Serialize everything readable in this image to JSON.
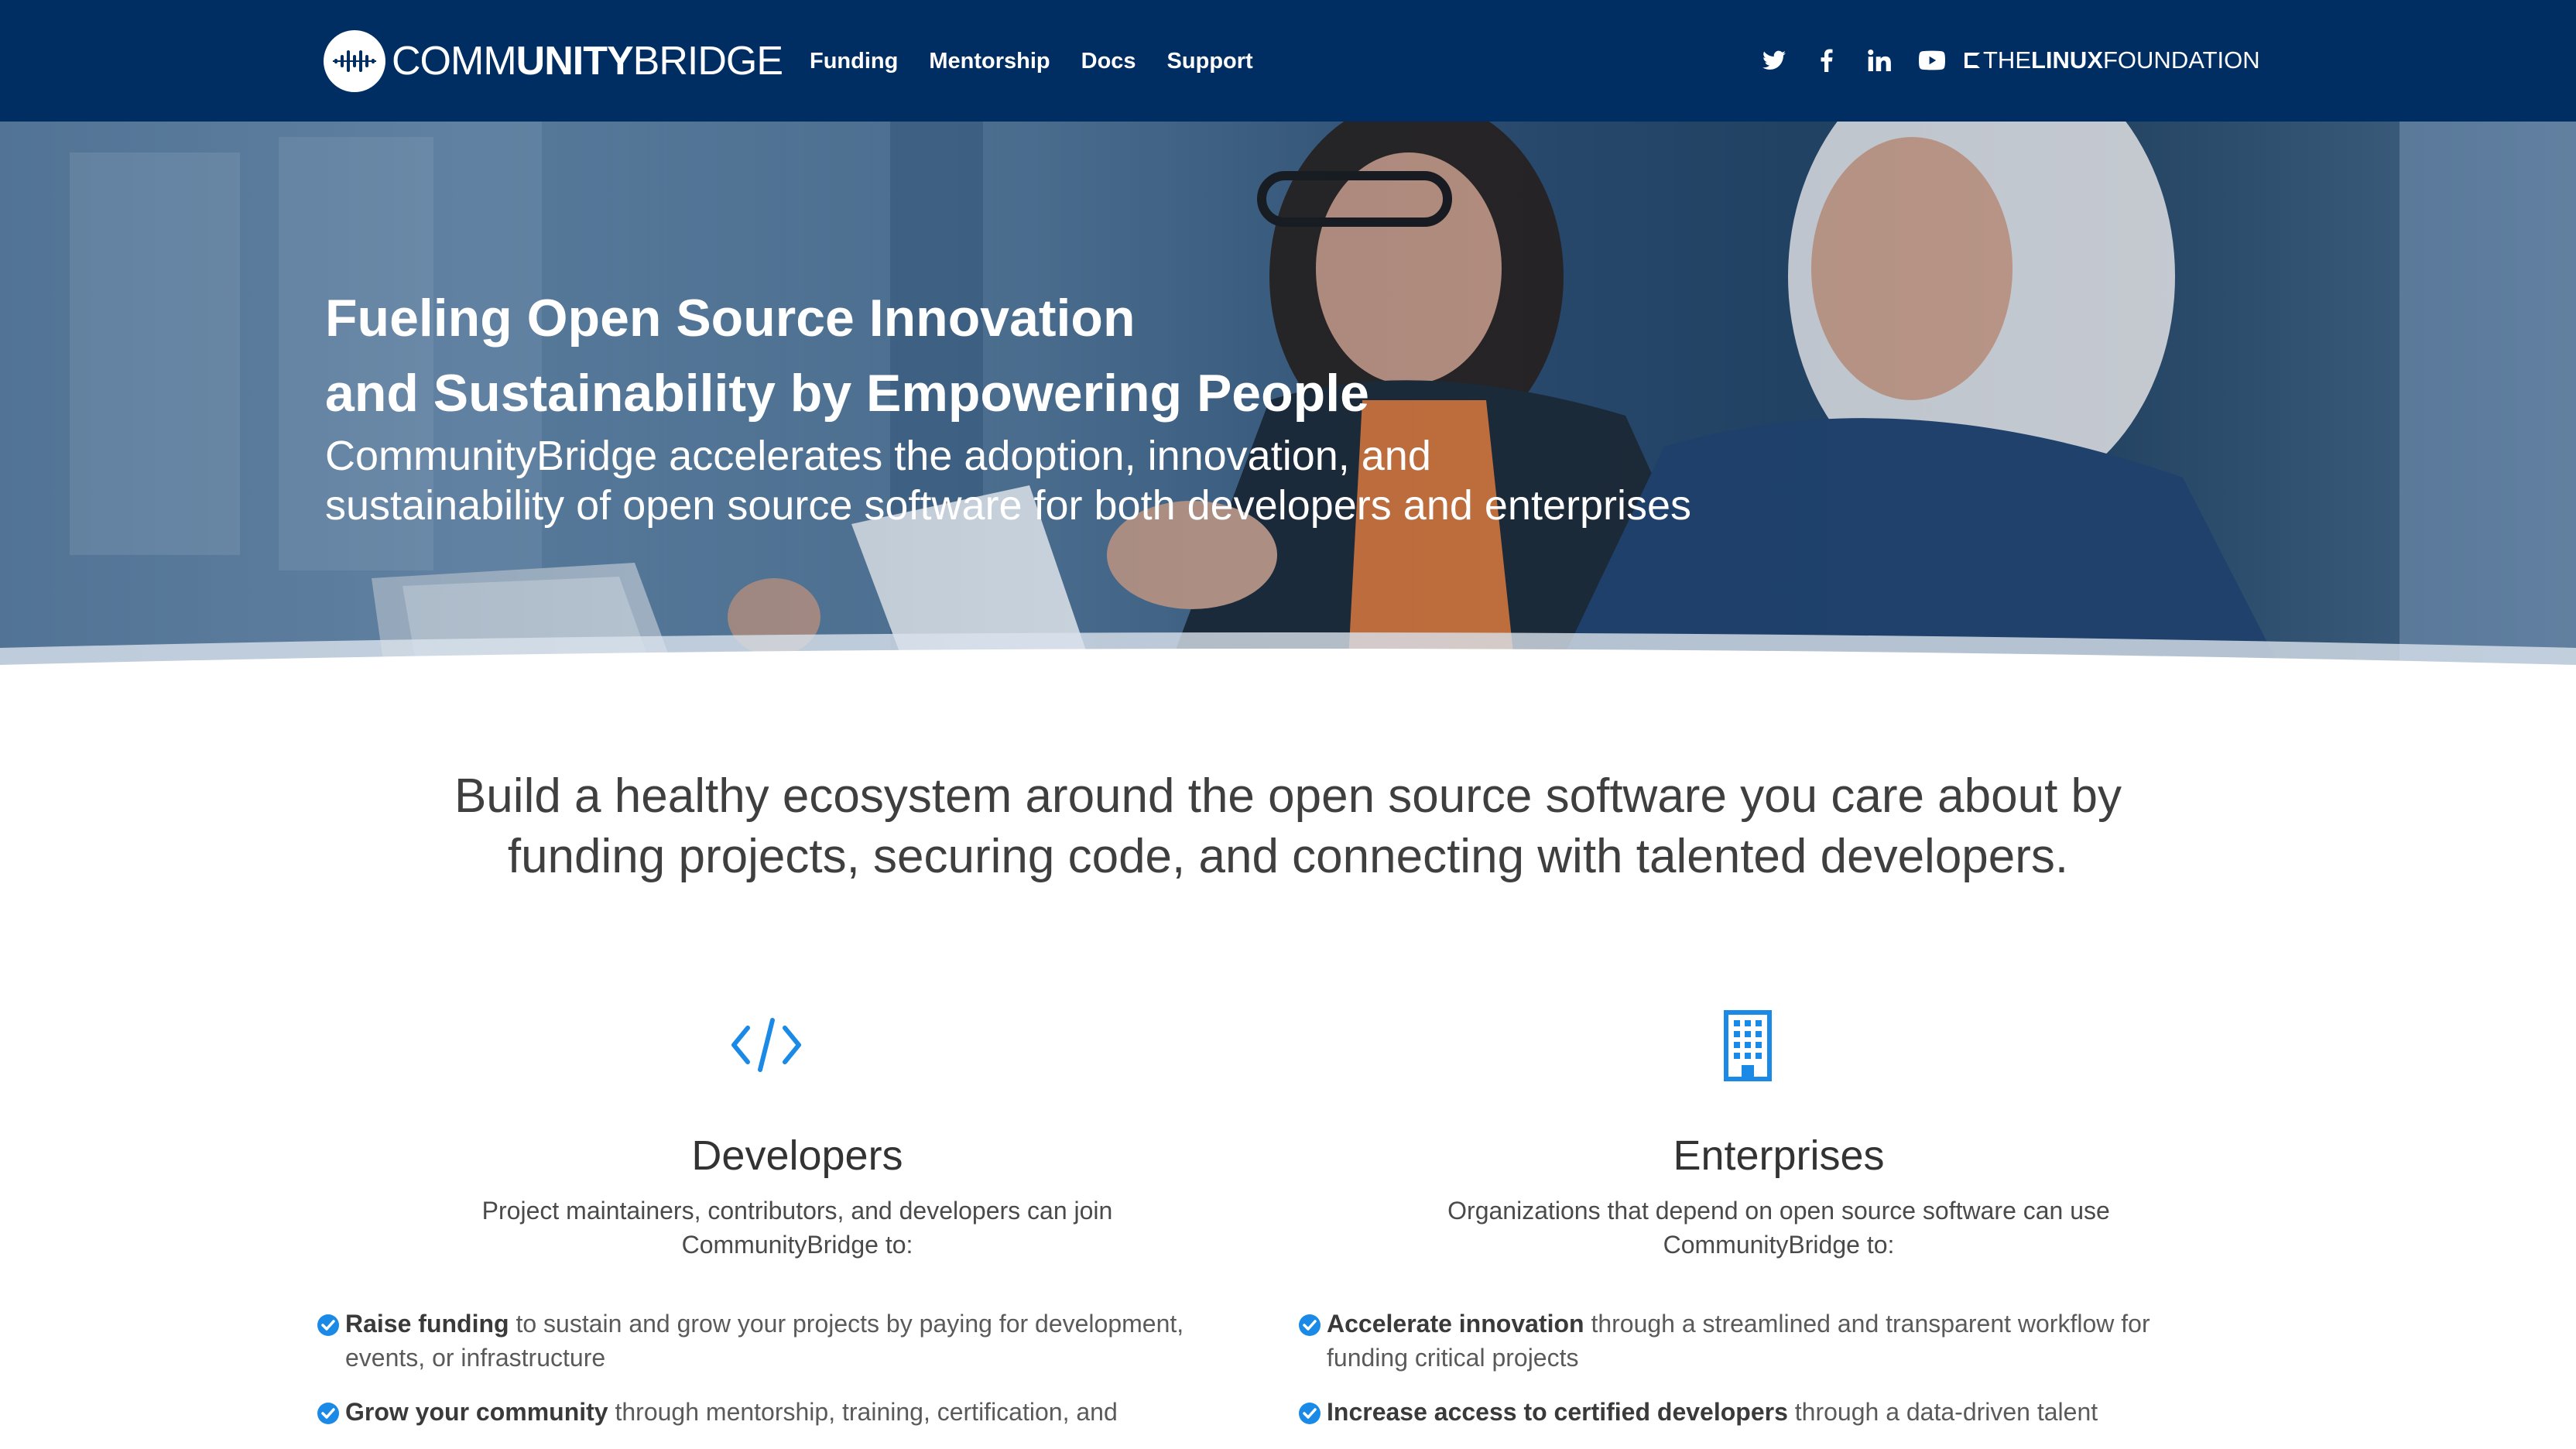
{
  "nav": {
    "logo_light": "COMM",
    "logo_bold": "UNITY",
    "logo_tail": "BRIDGE",
    "links": [
      "Funding",
      "Mentorship",
      "Docs",
      "Support"
    ],
    "socials": [
      "twitter-icon",
      "facebook-icon",
      "linkedin-icon",
      "youtube-icon"
    ],
    "lf_prefix": "THE",
    "lf_bold": "LINUX",
    "lf_suffix": "FOUNDATION"
  },
  "hero": {
    "title_line1": "Fueling Open Source Innovation",
    "title_line2": "and Sustainability by Empowering People",
    "subtitle_line1": "CommunityBridge accelerates the adoption, innovation, and",
    "subtitle_line2": "sustainability of open source software for both developers and enterprises"
  },
  "intro": {
    "line1": "Build a healthy ecosystem around the open source software you care about by",
    "line2": "funding projects, securing code, and connecting with talented developers."
  },
  "developers": {
    "icon": "code-icon",
    "title": "Developers",
    "desc_line1": "Project maintainers, contributors, and developers can join",
    "desc_line2": "CommunityBridge to:",
    "items": [
      {
        "bold": "Raise funding",
        "text": " to sustain and grow your projects by paying for development, events, or infrastructure"
      },
      {
        "bold": "Grow your community",
        "text": " through mentorship, training, certification, and"
      }
    ]
  },
  "enterprises": {
    "icon": "building-icon",
    "title": "Enterprises",
    "desc_line1": "Organizations that depend on open source software can use",
    "desc_line2": "CommunityBridge to:",
    "items": [
      {
        "bold": "Accelerate innovation",
        "text": " through a streamlined and transparent workflow for funding critical projects"
      },
      {
        "bold": "Increase access to certified developers",
        "text": " through a data-driven talent"
      }
    ]
  },
  "colors": {
    "nav_bg": "#002d62",
    "accent": "#1a8ae6",
    "text": "#3f3f3f"
  }
}
